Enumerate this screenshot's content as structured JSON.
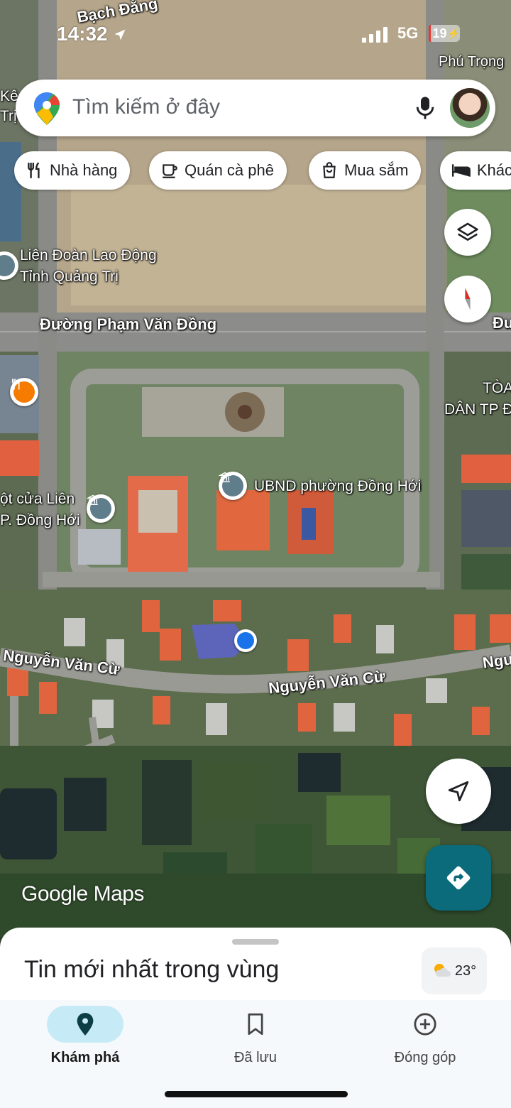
{
  "status_bar": {
    "time": "14:32",
    "network": "5G",
    "battery": "19"
  },
  "search": {
    "placeholder": "Tìm kiếm ở đây"
  },
  "chips": [
    "Nhà hàng",
    "Quán cà phê",
    "Mua sắm",
    "Khác"
  ],
  "map_labels": {
    "road_bach_dang": "Bạch Đằng",
    "phu_trong": "Phú Trọng",
    "ke_tri": "Kê\nTrị",
    "lien_doan": "Liên Đoàn Lao Động\nTỉnh Quảng Trị",
    "road_pham_van_dong": "Đường Phạm Văn Đồng",
    "road_pham_van_dong_right": "Đư",
    "toa": "TÒA\nDÂN TP Đ",
    "ubnd": "UBND phường Đồng Hới",
    "mot_cua": "ột cửa Liên\nP. Đồng Hới",
    "nguyen_van_cu_left": "Nguyễn Văn Cừ",
    "nguyen_van_cu_center": "Nguyễn Văn Cừ",
    "nguyen_van_cu_right": "Ngu"
  },
  "watermark": "Google Maps",
  "bottom_sheet": {
    "title": "Tin mới nhất trong vùng",
    "weather": "23°"
  },
  "nav": [
    {
      "label": "Khám phá",
      "active": true
    },
    {
      "label": "Đã lưu",
      "active": false
    },
    {
      "label": "Đóng góp",
      "active": false
    }
  ]
}
